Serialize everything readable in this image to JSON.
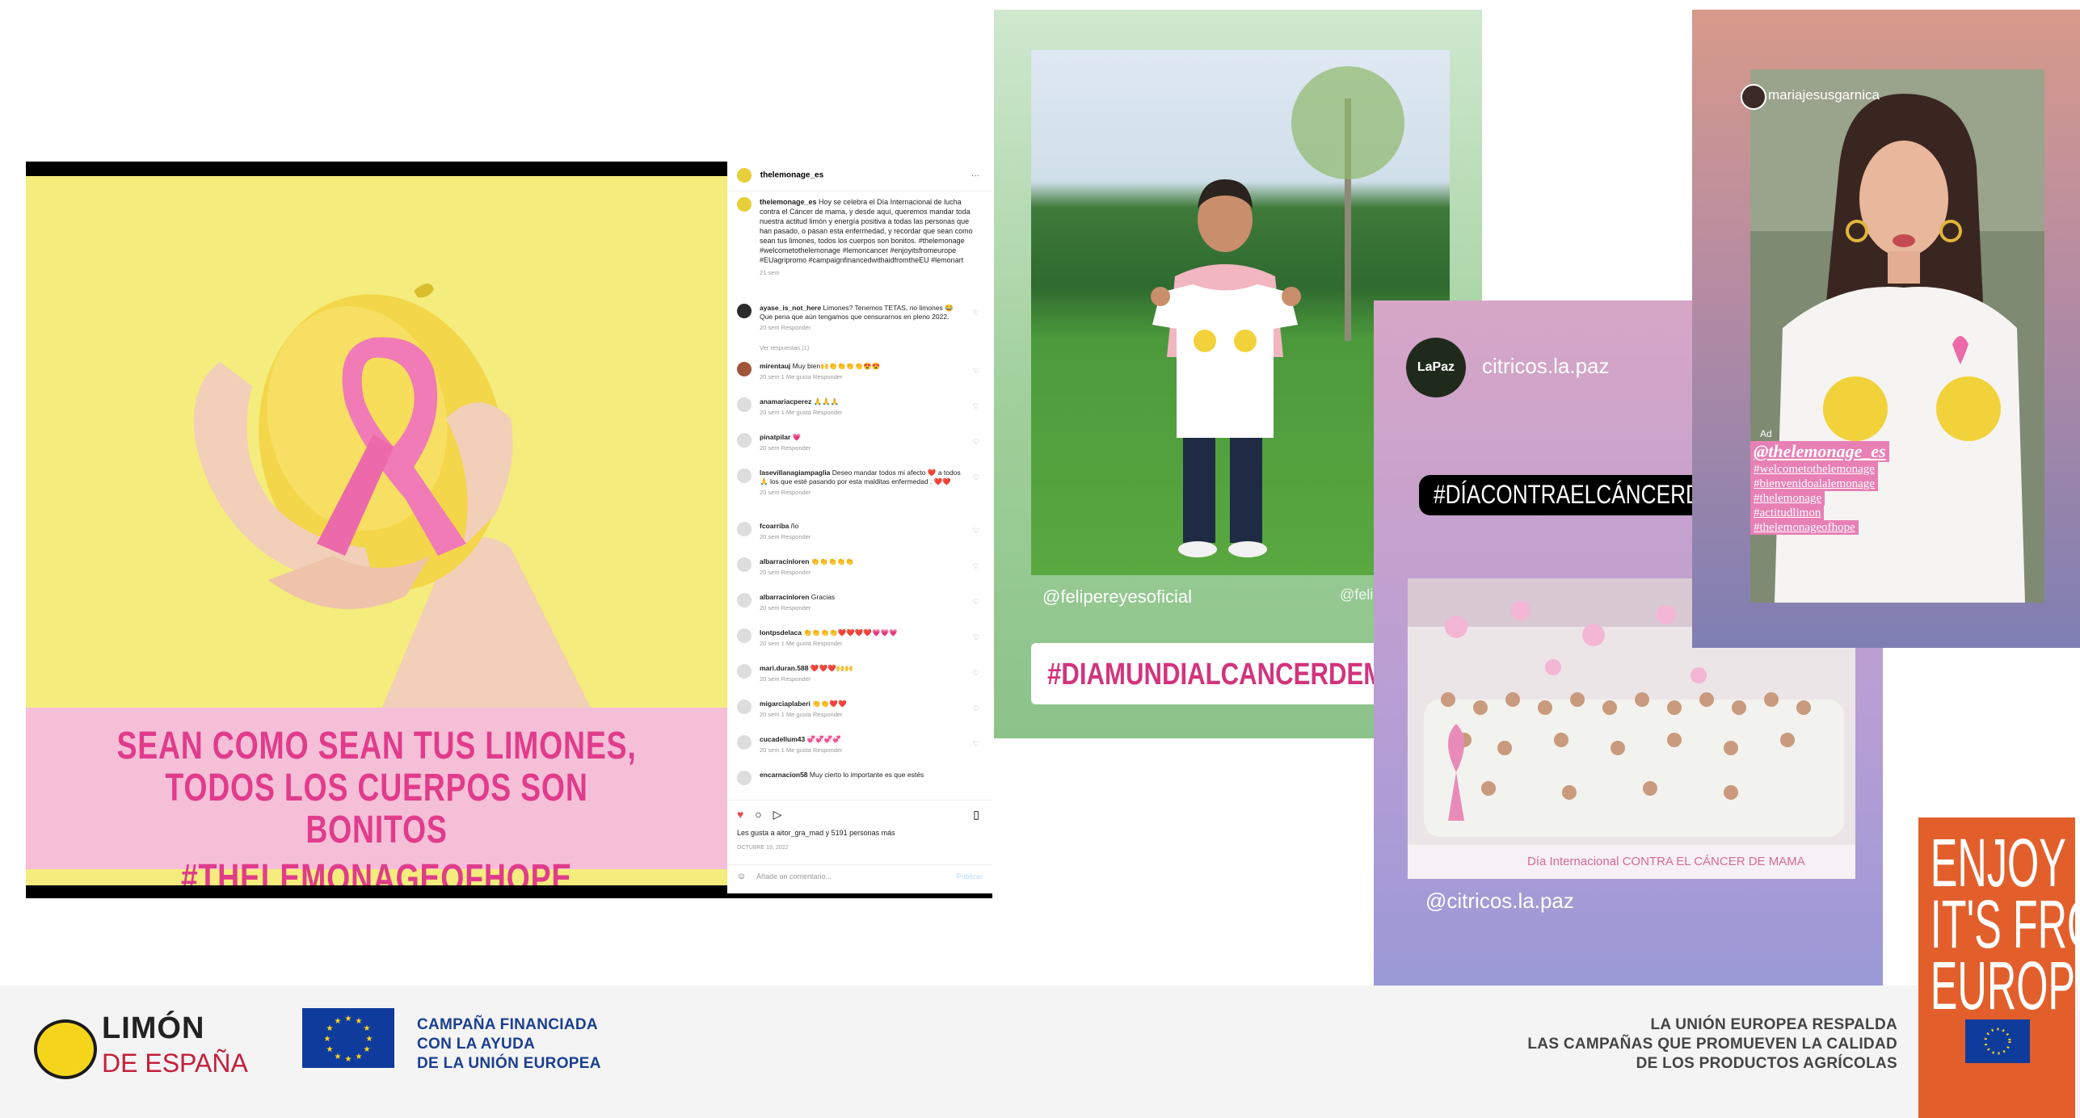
{
  "post": {
    "banner_lines": [
      "SEAN COMO SEAN TUS LIMONES,",
      "TODOS LOS CUERPOS SON BONITOS",
      "#THELEMONAGEOFHOPE"
    ],
    "username": "thelemonage_es",
    "more": "···",
    "caption_user": "thelemonage_es",
    "caption_text": "Hoy se celebra el Día Internacional de lucha contra el Cáncer de mama, y desde aquí, queremos mandar toda nuestra actitud limón y energía positiva a todas las personas que han pasado, o pasan esta enfermedad, y recordar que sean como sean tus limones, todos los cuerpos son bonitos. #thelemonage #welcometothelemonage #lemoncancer #enjoyitsfromeurope #EUagripromo #campaignfinancedwithaidfromtheEU #lemonart",
    "caption_time": "21 sem",
    "view_replies": "Ver respuestas (1)",
    "comments": [
      {
        "user": "ayase_is_not_here",
        "text": "Limones? Tenemos TETAS, no limones 😂 Que pena que aún tengamos que censurarnos en pleno 2022.",
        "meta": "20 sem   Responder"
      },
      {
        "user": "mirentauj",
        "text": "Muy bien🙌👏👏👏👏😍😍",
        "meta": "20 sem   1 Me gusta   Responder"
      },
      {
        "user": "anamariacperez",
        "text": "🙏🙏🙏",
        "meta": "20 sem   1 Me gusta   Responder"
      },
      {
        "user": "pinatpilar",
        "text": "💗",
        "meta": "20 sem   Responder"
      },
      {
        "user": "lasevillanagiampaglia",
        "text": "Deseo mandar todos mi afecto ❤️ a todos 🙏 los que esté pasando por esta malditas enfermedad . ❤️❤️",
        "meta": "20 sem   Responder"
      },
      {
        "user": "fcoarriba",
        "text": "ño",
        "meta": "20 sem   Responder"
      },
      {
        "user": "albarracinloren",
        "text": "👏👏👏👏👏",
        "meta": "20 sem   Responder"
      },
      {
        "user": "albarracinloren",
        "text": "Gracias",
        "meta": "20 sem   Responder"
      },
      {
        "user": "lontpsdelaca",
        "text": "👏👏👏👏❤️❤️❤️❤️💗💗💗",
        "meta": "20 sem   1 Me gusta   Responder"
      },
      {
        "user": "mari.duran.588",
        "text": "❤️❤️❤️🙌🙌",
        "meta": "20 sem   Responder"
      },
      {
        "user": "migarciaplaberi",
        "text": "👏👏❤️❤️",
        "meta": "20 sem   1 Me gusta   Responder"
      },
      {
        "user": "cucadellum43",
        "text": "💞💞💞💞",
        "meta": "20 sem   1 Me gusta   Responder"
      },
      {
        "user": "encarnacion58",
        "text": "Muy cierto lo importante es que estés",
        "meta": ""
      }
    ],
    "icons": {
      "like": "♥",
      "comment": "○",
      "share": "▷",
      "save": "▯"
    },
    "likes_text": "Les gusta a aitor_gra_mad y 5191 personas más",
    "date": "OCTUBRE 19, 2022",
    "add_comment_placeholder": "Añade un comentario...",
    "publish": "Publicar"
  },
  "story1": {
    "handle": "@felipereyesoficial",
    "handle_cut": "@felip",
    "hashtag": "#DIAMUNDIALCANCERDEMAMA"
  },
  "story2": {
    "logo_text": "LaPaz",
    "account": "citricos.la.paz",
    "hashtag": "#DÍACONTRAELCÁNCERDEMAMA",
    "photo_caption": "Día Internacional CONTRA EL CÁNCER DE MAMA",
    "handle": "@citricos.la.paz"
  },
  "story3": {
    "user": "mariajesusgarnica",
    "ad": "Ad",
    "mention": "@thelemonage_es",
    "tags": [
      "#welcometothelemonage",
      "#bienvenidoalalemonage",
      "#thelemonage",
      "#actitudlimon",
      "#thelemonageofhope"
    ]
  },
  "footer": {
    "brand_line1": "LIMÓN",
    "brand_line2": "DE ESPAÑA",
    "campaign_lines": [
      "CAMPAÑA FINANCIADA",
      "CON LA AYUDA",
      "DE LA UNIÓN EUROPEA"
    ],
    "support_lines": [
      "LA UNIÓN EUROPEA RESPALDA",
      "LAS CAMPAÑAS QUE PROMUEVEN LA CALIDAD",
      "DE LOS PRODUCTOS AGRÍCOLAS"
    ],
    "enjoy_lines": [
      "ENJOY",
      "IT'S FROM",
      "EUROPE"
    ]
  },
  "colors": {
    "banner_pink": "#f6bfd8",
    "banner_text": "#e13c8c",
    "lemon_yellow": "#f5d51c",
    "eu_blue": "#0f3c9c",
    "enjoy_orange": "#e25f2c"
  }
}
